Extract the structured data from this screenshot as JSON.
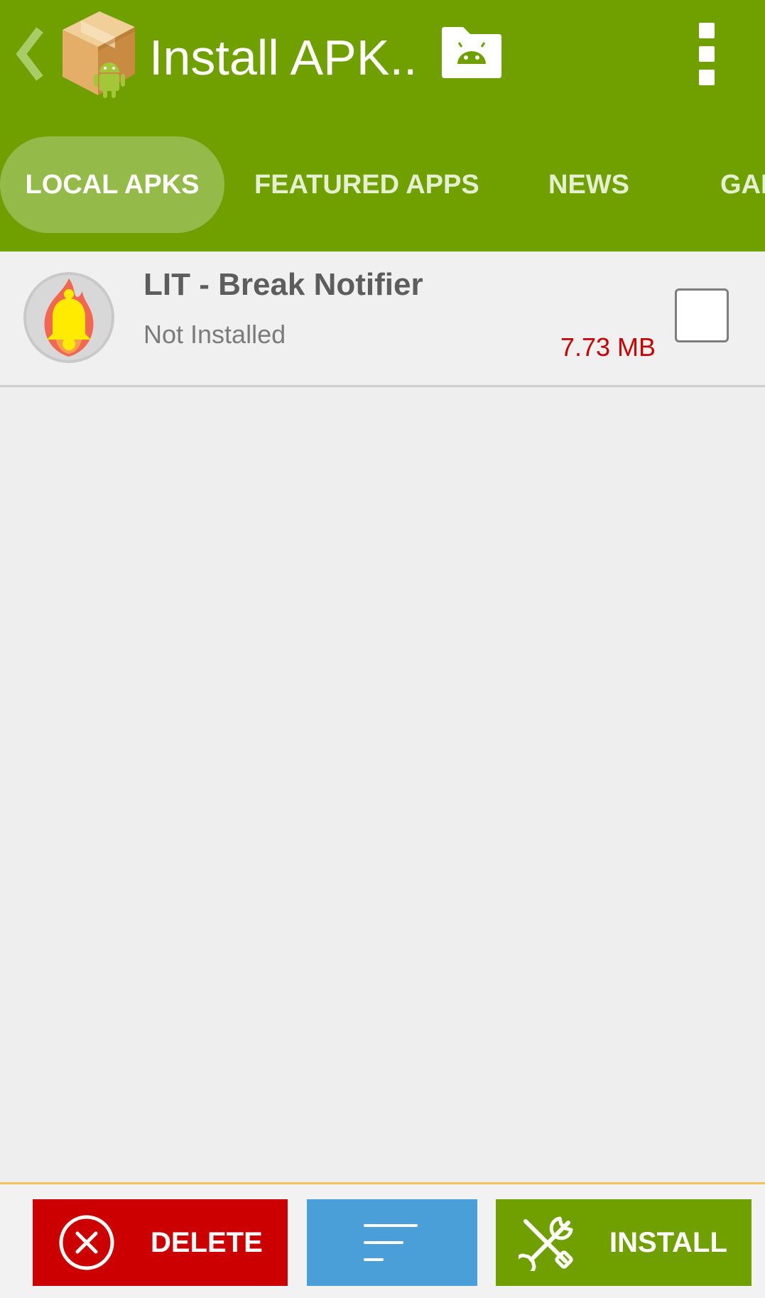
{
  "header": {
    "title": "Install APK..",
    "back_icon": "chevron-left-icon",
    "logo_icon": "apk-box-android-icon",
    "folder_icon": "android-folder-icon",
    "menu_icon": "overflow-menu-icon"
  },
  "tabs": [
    {
      "label": "LOCAL APKS",
      "active": true
    },
    {
      "label": "FEATURED APPS",
      "active": false
    },
    {
      "label": "NEWS",
      "active": false
    },
    {
      "label": "GAI",
      "active": false
    }
  ],
  "apk_list": [
    {
      "name": "LIT - Break Notifier",
      "status": "Not Installed",
      "size": "7.73 MB",
      "icon": "fire-bell-icon",
      "checked": false
    }
  ],
  "bottom_bar": {
    "delete_label": "DELETE",
    "sort_icon": "sort-lines-icon",
    "install_label": "INSTALL"
  },
  "colors": {
    "primary": "#6fa000",
    "tab_active": "#94bb4a",
    "delete": "#cc0000",
    "sort": "#4a9fd9",
    "size_text": "#c80000",
    "bottom_border": "#f5c15a"
  }
}
